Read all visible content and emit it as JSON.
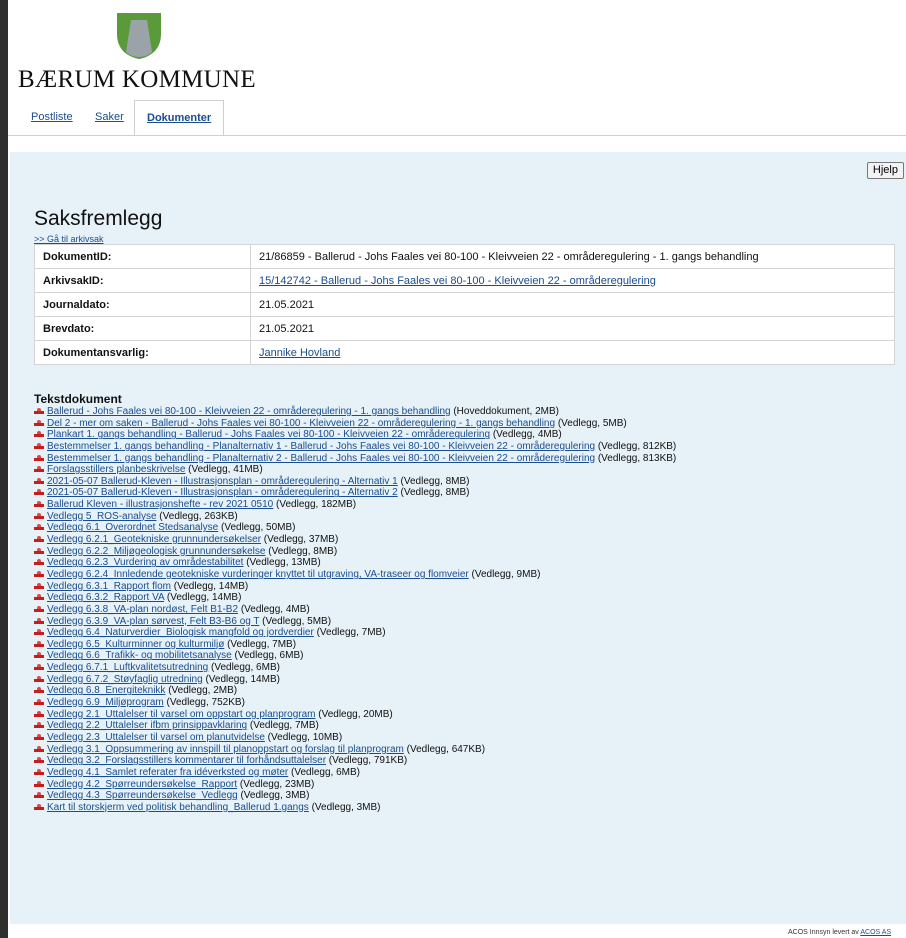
{
  "header": {
    "brand": "BÆRUM KOMMUNE",
    "colors": {
      "logo_green": "#5a9a3a",
      "logo_gray": "#9aa3a8",
      "panel": "#e6f1f8",
      "link": "#1a4d8f"
    }
  },
  "tabs": [
    {
      "label": "Postliste",
      "active": false
    },
    {
      "label": "Saker",
      "active": false
    },
    {
      "label": "Dokumenter",
      "active": true
    }
  ],
  "help_label": "Hjelp",
  "doc": {
    "title": "Saksfremlegg",
    "archive_link": ">> Gå til arkivsak",
    "meta": [
      {
        "key": "DokumentID:",
        "value": "21/86859 - Ballerud - Johs Faales vei 80-100 - Kleivveien 22 - områderegulering - 1. gangs behandling",
        "link": false
      },
      {
        "key": "ArkivsakID:",
        "value": "15/142742 - Ballerud - Johs Faales vei 80-100 - Kleivveien 22 - områderegulering",
        "link": true
      },
      {
        "key": "Journaldato:",
        "value": "21.05.2021",
        "link": false
      },
      {
        "key": "Brevdato:",
        "value": "21.05.2021",
        "link": false
      },
      {
        "key": "Dokumentansvarlig:",
        "value": "Jannike Hovland",
        "link": true
      }
    ]
  },
  "files_heading": "Tekstdokument",
  "files": [
    {
      "name": "Ballerud - Johs Faales vei 80-100 - Kleivveien 22 - områderegulering - 1. gangs behandling",
      "info": " (Hoveddokument, 2MB)"
    },
    {
      "name": "Del 2 - mer om saken - Ballerud - Johs Faales vei 80-100 - Kleivveien 22 - områderegulering - 1. gangs behandling",
      "info": " (Vedlegg, 5MB)"
    },
    {
      "name": "Plankart 1. gangs behandling - Ballerud - Johs Faales vei 80-100 - Kleivveien 22 - områderegulering",
      "info": " (Vedlegg, 4MB)"
    },
    {
      "name": "Bestemmelser 1. gangs behandling - Planalternativ 1 - Ballerud - Johs Faales vei 80-100 - Kleivveien 22 - områderegulering",
      "info": " (Vedlegg, 812KB)"
    },
    {
      "name": "Bestemmelser 1. gangs behandling - Planalternativ 2 - Ballerud - Johs Faales vei 80-100 - Kleivveien 22 - områderegulering",
      "info": " (Vedlegg, 813KB)"
    },
    {
      "name": "Forslagsstillers planbeskrivelse",
      "info": " (Vedlegg, 41MB)"
    },
    {
      "name": "2021-05-07 Ballerud-Kleven - Illustrasjonsplan - områderegulering - Alternativ 1",
      "info": " (Vedlegg, 8MB)"
    },
    {
      "name": "2021-05-07 Ballerud-Kleven - Illustrasjonsplan - områderegulering - Alternativ 2",
      "info": " (Vedlegg, 8MB)"
    },
    {
      "name": "Ballerud Kleven - illustrasjonshefte - rev 2021 0510",
      "info": " (Vedlegg, 182MB)"
    },
    {
      "name": "Vedlegg 5_ROS-analyse",
      "info": " (Vedlegg, 263KB)"
    },
    {
      "name": "Vedlegg 6.1_Overordnet Stedsanalyse",
      "info": " (Vedlegg, 50MB)"
    },
    {
      "name": "Vedlegg 6.2.1_Geotekniske grunnundersøkelser",
      "info": " (Vedlegg, 37MB)"
    },
    {
      "name": "Vedlegg 6.2.2_Miljøgeologisk grunnundersøkelse",
      "info": " (Vedlegg, 8MB)"
    },
    {
      "name": "Vedlegg 6.2.3_Vurdering av områdestabilitet",
      "info": " (Vedlegg, 13MB)"
    },
    {
      "name": "Vedlegg 6.2.4_Innledende geotekniske vurderinger knyttet til utgraving, VA-traseer og flomveier",
      "info": " (Vedlegg, 9MB)"
    },
    {
      "name": "Vedlegg 6.3.1_Rapport flom",
      "info": " (Vedlegg, 14MB)"
    },
    {
      "name": "Vedlegg 6.3.2_Rapport VA",
      "info": " (Vedlegg, 14MB)"
    },
    {
      "name": "Vedlegg 6.3.8_VA-plan nordøst, Felt B1-B2",
      "info": " (Vedlegg, 4MB)"
    },
    {
      "name": "Vedlegg 6.3.9_VA-plan sørvest, Felt B3-B6 og T",
      "info": " (Vedlegg, 5MB)"
    },
    {
      "name": "Vedlegg 6.4_Naturverdier_Biologisk mangfold og jordverdier",
      "info": " (Vedlegg, 7MB)"
    },
    {
      "name": "Vedlegg 6.5_Kulturminner og kulturmiljø",
      "info": " (Vedlegg, 7MB)"
    },
    {
      "name": "Vedlegg 6.6_Trafikk- og mobilitetsanalyse",
      "info": " (Vedlegg, 6MB)"
    },
    {
      "name": "Vedlegg 6.7.1_Luftkvalitetsutredning",
      "info": " (Vedlegg, 6MB)"
    },
    {
      "name": "Vedlegg 6.7.2_Støyfaglig utredning",
      "info": " (Vedlegg, 14MB)"
    },
    {
      "name": "Vedlegg 6.8_Energiteknikk",
      "info": " (Vedlegg, 2MB)"
    },
    {
      "name": "Vedlegg 6.9_Miljøprogram",
      "info": " (Vedlegg, 752KB)"
    },
    {
      "name": "Vedlegg 2.1_Uttalelser til varsel om oppstart og planprogram",
      "info": " (Vedlegg, 20MB)"
    },
    {
      "name": "Vedlegg 2.2_Uttalelser ifbm prinsippavklaring",
      "info": " (Vedlegg, 7MB)"
    },
    {
      "name": "Vedlegg 2.3_Uttalelser til varsel om planutvidelse",
      "info": " (Vedlegg, 10MB)"
    },
    {
      "name": "Vedlegg 3.1_Oppsummering av innspill til planoppstart og forslag til planprogram",
      "info": " (Vedlegg, 647KB)"
    },
    {
      "name": "Vedlegg 3.2_Forslagsstillers kommentarer til forhåndsuttalelser",
      "info": " (Vedlegg, 791KB)"
    },
    {
      "name": "Vedlegg 4.1_Samlet referater fra idéverksted og møter",
      "info": " (Vedlegg, 6MB)"
    },
    {
      "name": "Vedlegg 4.2_Spørreundersøkelse_Rapport",
      "info": " (Vedlegg, 23MB)"
    },
    {
      "name": "Vedlegg 4.3_Spørreundersøkelse_Vedlegg",
      "info": " (Vedlegg, 3MB)"
    },
    {
      "name": "Kart til storskjerm ved politisk behandling_Ballerud 1.gangs",
      "info": " (Vedlegg, 3MB)"
    }
  ],
  "footer": {
    "text": "ACOS Innsyn levert av ",
    "link": "ACOS AS"
  }
}
